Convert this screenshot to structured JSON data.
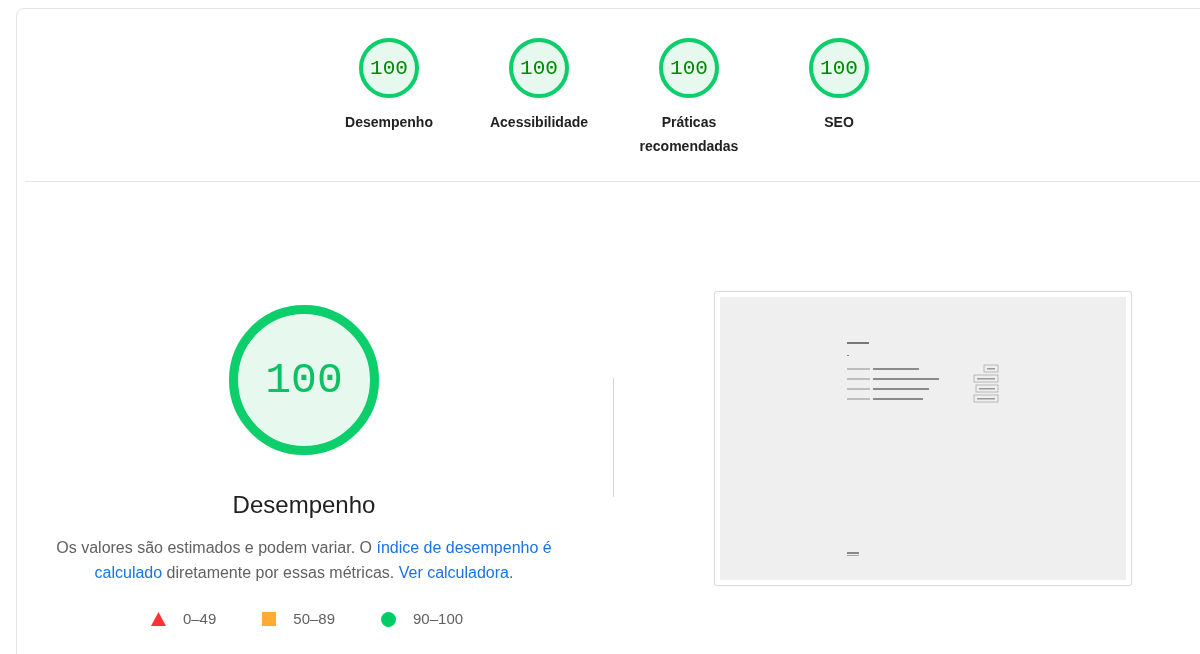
{
  "categories": [
    {
      "score": "100",
      "level": 1,
      "label": "Desempenho"
    },
    {
      "score": "100",
      "level": 1,
      "label": "Acessibilidade"
    },
    {
      "score": "100",
      "level": 1,
      "label": "Práticas recomendadas"
    },
    {
      "score": "100",
      "level": 1,
      "label": "SEO"
    }
  ],
  "performance": {
    "score": "100",
    "level": 1,
    "title": "Desempenho",
    "description": [
      {
        "kind": "text",
        "text": "Os valores são estimados e podem variar. O "
      },
      {
        "kind": "link",
        "text": "índice de desempenho é"
      },
      {
        "kind": "link",
        "text": "calculado"
      },
      {
        "kind": "text",
        "text": " diretamente por essas métricas. "
      },
      {
        "kind": "link",
        "text": "Ver calculadora"
      },
      {
        "kind": "text",
        "text": "."
      }
    ],
    "legend": [
      {
        "kind": "triangle",
        "label": "0–49",
        "color": "#ff3333"
      },
      {
        "kind": "square",
        "label": "50–89",
        "color": "#ffaa33"
      },
      {
        "kind": "circle",
        "label": "90–100",
        "color": "#00cc66"
      }
    ]
  }
}
